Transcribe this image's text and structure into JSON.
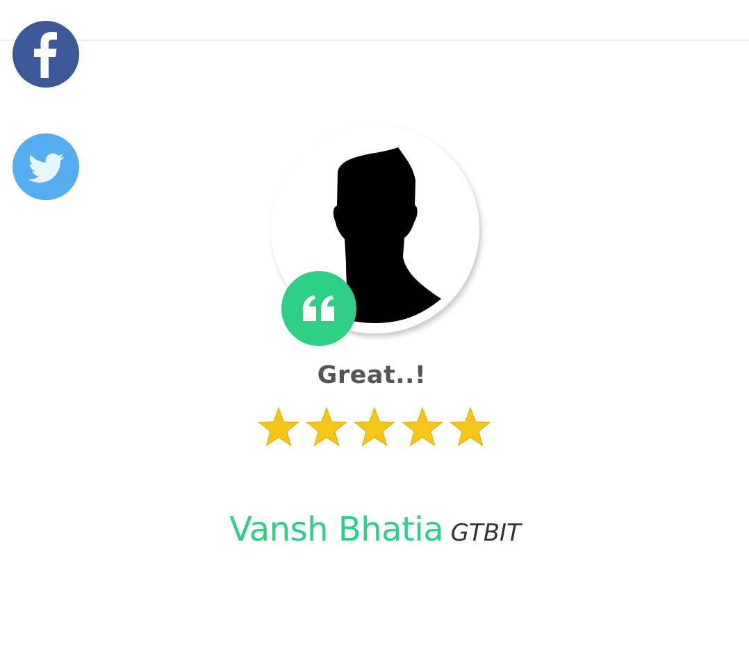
{
  "colors": {
    "facebook": "#3b5998",
    "twitter": "#55acee",
    "accent_green": "#2ecf85",
    "star_gold": "#f5c518",
    "title_gray": "#555555"
  },
  "social": [
    {
      "name": "facebook",
      "icon": "facebook-icon"
    },
    {
      "name": "twitter",
      "icon": "twitter-icon"
    }
  ],
  "testimonial": {
    "avatar_icon": "user-silhouette-icon",
    "quote_icon": "quote-icon",
    "title": "Great..!",
    "rating": 5,
    "rating_max": 5,
    "reviewer_name": "Vansh Bhatia",
    "reviewer_org": "GTBIT"
  }
}
